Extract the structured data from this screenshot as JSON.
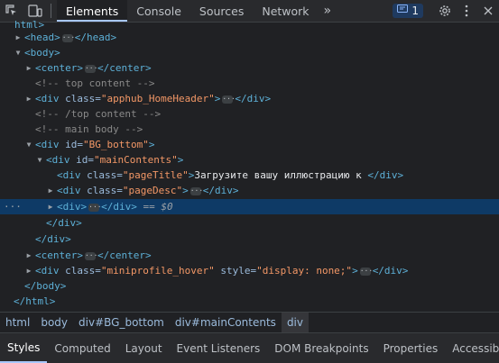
{
  "toolbar": {
    "tabs": [
      "Elements",
      "Console",
      "Sources",
      "Network"
    ],
    "more_symbol": "»",
    "issues_count": "1"
  },
  "dom_tree": {
    "top_fragment": "html>",
    "head_open": "<head>",
    "head_close": "</head>",
    "body_open": "<body>",
    "center_open": "<center>",
    "center_close": "</center>",
    "comment_top": "<!-- top content -->",
    "div_open_prefix": "<div ",
    "attr_class": "class=",
    "attr_id": "id=",
    "attr_style": "style=",
    "val_apphub": "\"apphub_HomeHeader\"",
    "gt": ">",
    "div_close": "</div>",
    "comment_top_end": "<!-- /top content -->",
    "comment_main": "<!-- main body -->",
    "val_bg_bottom": "\"BG_bottom\"",
    "val_main_contents": "\"mainContents\"",
    "val_page_title": "\"pageTitle\"",
    "page_title_text": "Загрузите вашу иллюстрацию к ",
    "val_page_desc": "\"pageDesc\"",
    "div_open_plain": "<div>",
    "selected_suffix_eq": "==",
    "selected_suffix_var": "$0",
    "val_miniprofile": "\"miniprofile_hover\"",
    "val_style_none": "\"display: none;\"",
    "body_close": "</body>",
    "html_close": "</html>",
    "row_dots": "···"
  },
  "breadcrumbs": [
    "html",
    "body",
    "div#BG_bottom",
    "div#mainContents",
    "div"
  ],
  "bottom_tabs": [
    "Styles",
    "Computed",
    "Layout",
    "Event Listeners",
    "DOM Breakpoints",
    "Properties",
    "Accessibility"
  ]
}
